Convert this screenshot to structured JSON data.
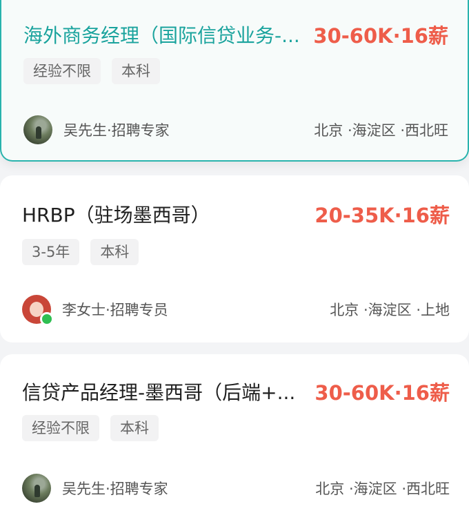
{
  "jobs": [
    {
      "title": "海外商务经理（国际信贷业务-...",
      "salary": "30-60K·16薪",
      "tags": [
        "经验不限",
        "本科"
      ],
      "recruiter": "吴先生·招聘专家",
      "location": "北京 ·海淀区 ·西北旺",
      "avatar": "landscape-photo",
      "highlight_color": "#29b3ad"
    },
    {
      "title": "HRBP（驻场墨西哥）",
      "salary": "20-35K·16薪",
      "tags": [
        "3-5年",
        "本科"
      ],
      "recruiter": "李女士·招聘专员",
      "location": "北京 ·海淀区 ·上地",
      "avatar": "illustrated-girl",
      "online": true
    },
    {
      "title": "信贷产品经理-墨西哥（后端+...",
      "salary": "30-60K·16薪",
      "tags": [
        "经验不限",
        "本科"
      ],
      "recruiter": "吴先生·招聘专家",
      "location": "北京 ·海淀区 ·西北旺",
      "avatar": "landscape-photo"
    }
  ],
  "colors": {
    "salary": "#ee5d4a",
    "selected_title": "#1aa39d",
    "online": "#2fbf52"
  }
}
